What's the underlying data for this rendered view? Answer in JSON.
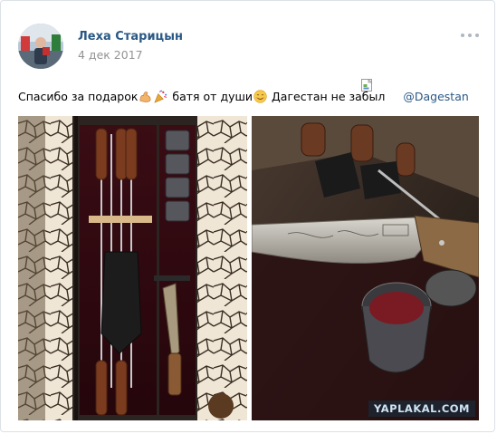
{
  "post": {
    "author_name": "Леха Старицын",
    "date": "4 дек 2017",
    "text_part1": "Спасибо за подарок",
    "text_part2": " батя от души",
    "text_part3": " Дагестан не забыл",
    "hashtag": "@Dagestan",
    "emojis": [
      "flexed-biceps-emoji",
      "party-popper-emoji",
      "smiling-face-emoji"
    ]
  },
  "photos": [
    {
      "name": "shashlik-set-case-photo"
    },
    {
      "name": "knife-closeup-photo",
      "watermark": "YAPLAKAL.COM"
    }
  ],
  "colors": {
    "link": "#2a5885",
    "date": "#939393",
    "border": "#dce1e6"
  }
}
